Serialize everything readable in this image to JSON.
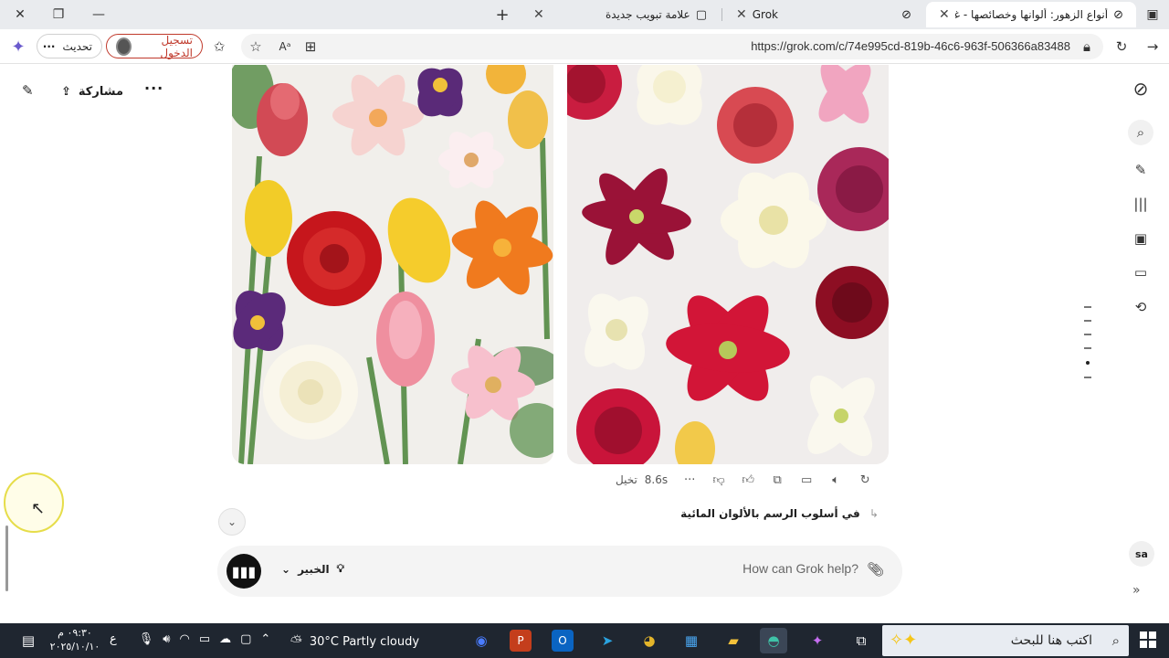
{
  "browser": {
    "tabs": [
      {
        "title": "أنواع الزهور: ألوانها وخصائصها - غرو",
        "active": true
      },
      {
        "title": "Grok",
        "active": false
      },
      {
        "title": "علامة تبويب جديدة",
        "active": false
      }
    ],
    "url": "https://grok.com/c/74e995cd-819b-46c6-963f-506366a83488",
    "signin_label": "تسجيل الدخول",
    "update_label": "تحديث"
  },
  "header": {
    "share_label": "مشاركة"
  },
  "message": {
    "time_label": "8.6s",
    "mode_label": "تخيل"
  },
  "followup": {
    "text": "في أسلوب الرسم بالألوان المائية"
  },
  "composer": {
    "placeholder": "How can Grok help?",
    "model_label": "الخبير"
  },
  "sidebar": {
    "user_initials": "sa"
  },
  "taskbar": {
    "weather": "30°C  Partly cloudy",
    "search_placeholder": "اكتب هنا للبحث",
    "time": "٠٩:٣٠ م",
    "date": "٢٠٢٥/١٠/١٠",
    "lang": "ع"
  },
  "colors": {
    "signin_red": "#c0392b",
    "taskbar_bg": "#1f2630"
  }
}
